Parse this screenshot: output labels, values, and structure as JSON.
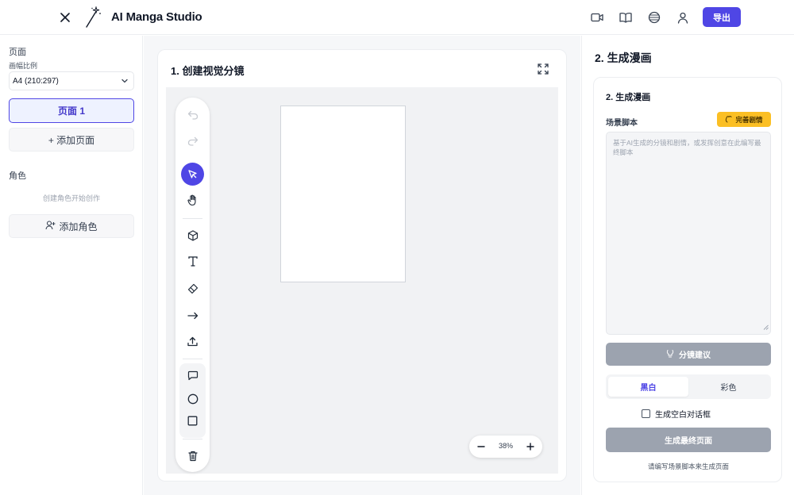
{
  "header": {
    "app_title": "AI Manga Studio",
    "export_label": "导出",
    "icons": [
      "close-icon",
      "magic-wand-logo",
      "video-icon",
      "book-icon",
      "globe-icon",
      "user-icon"
    ]
  },
  "left_panel": {
    "pages_heading": "页面",
    "aspect_label": "画幅比例",
    "aspect_value": "A4 (210:297)",
    "page_item": "页面 1",
    "add_page": "+ 添加页面",
    "characters_heading": "角色",
    "characters_hint": "创建角色开始创作",
    "add_character": "添加角色"
  },
  "storyboard": {
    "title": "1. 创建视觉分镜",
    "zoom_level": "38%",
    "tools": [
      "undo",
      "redo",
      "select",
      "hand",
      "3d-object",
      "text",
      "eraser",
      "arrow",
      "upload",
      "speech-bubble",
      "circle",
      "rectangle",
      "delete"
    ]
  },
  "right_panel": {
    "title": "2. 生成漫画",
    "card_title": "2. 生成漫画",
    "script_label": "场景脚本",
    "improve_label": "完善剧情",
    "script_placeholder": "基于AI生成的分镜和剧情，或发挥创意在此编写最终脚本",
    "suggest_label": "分镜建议",
    "mode_bw": "黑白",
    "mode_color": "彩色",
    "blank_bubbles_label": "生成空白对话框",
    "generate_label": "生成最终页面",
    "footer_hint": "请编写场景脚本来生成页面"
  },
  "colors": {
    "accent": "#4f46e5",
    "improve": "#fbbf24",
    "disabled": "#9ca3af"
  }
}
